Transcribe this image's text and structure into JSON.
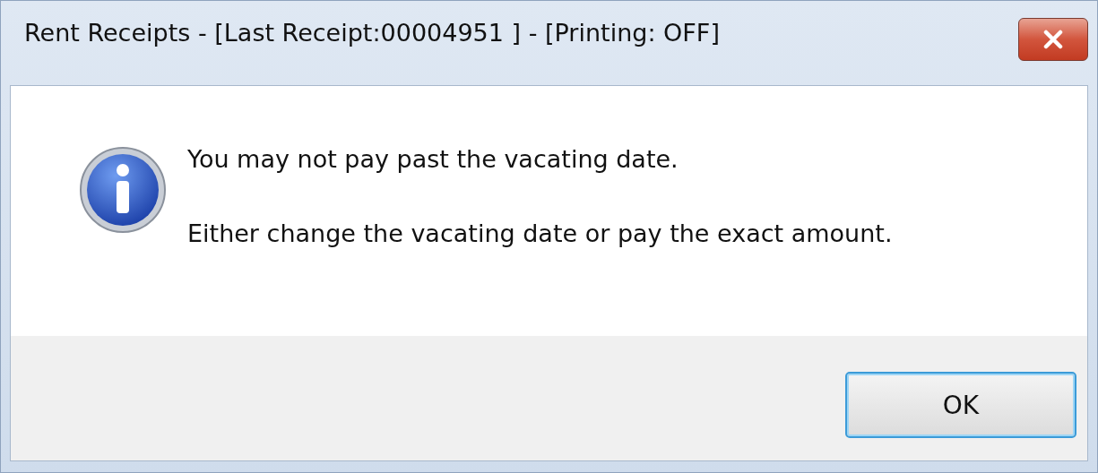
{
  "window": {
    "title": "Rent Receipts - [Last Receipt:00004951 ] - [Printing: OFF]"
  },
  "message": {
    "lines": [
      "You may not pay past the vacating date.",
      "Either change the vacating date or pay the exact amount."
    ]
  },
  "buttons": [
    {
      "label": "OK",
      "selected": true
    }
  ]
}
